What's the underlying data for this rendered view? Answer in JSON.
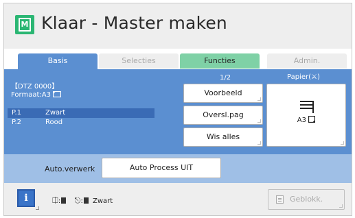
{
  "header": {
    "title": "Klaar - Master maken",
    "title_icon": "master-icon",
    "title_icon_letter": "M",
    "title_icon_color": "#2bb673"
  },
  "tabs": {
    "basis": "Basis",
    "selecties": "Selecties",
    "functies": "Functies",
    "admin": "Admin.",
    "active": "Basis",
    "active_color": "#5b8fd1",
    "functies_color": "#7fd1a6"
  },
  "info": {
    "dtz": "【DTZ 0000】",
    "format": "Formaat:A3",
    "colors": [
      {
        "page": "P.1",
        "color": "Zwart"
      },
      {
        "page": "P.2",
        "color": "Rood"
      }
    ]
  },
  "controls": {
    "pager": "1/2",
    "paper_label": "Papier(⚔)",
    "voorbeeld": "Voorbeeld",
    "oversl": "Oversl.pag",
    "wis": "Wis alles",
    "paper_size": "A3"
  },
  "auto": {
    "label": "Auto.verwerk",
    "button": "Auto Process UIT"
  },
  "footer": {
    "info_letter": "i",
    "ink_status": "Zwart",
    "geblokk": "Geblokk."
  }
}
